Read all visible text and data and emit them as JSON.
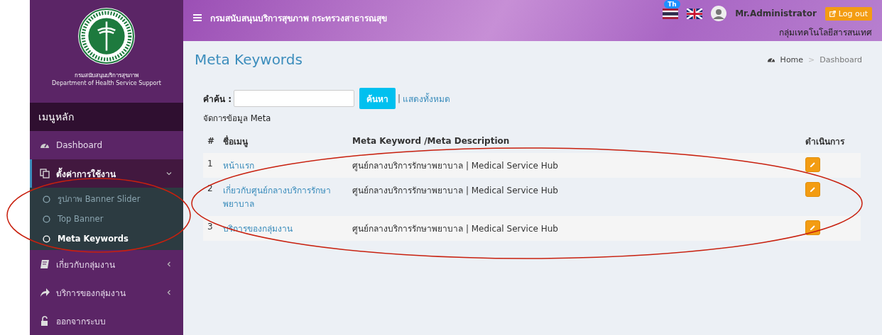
{
  "header": {
    "title": "กรมสนับสนุนบริการสุขภาพ กระทรวงสาธารณสุข",
    "language_badge": "Th",
    "user_name": "Mr.Administrator",
    "logout": "Log out",
    "department": "กลุ่มเทคโนโลยีสารสนเทศ"
  },
  "sidebar": {
    "org_name_th": "กรมสนับสนุนบริการสุขภาพ",
    "org_name_en": "Department of Health Service Support",
    "menu_heading": "เมนูหลัก",
    "items": [
      {
        "kind": "link",
        "label": "Dashboard"
      },
      {
        "kind": "group",
        "label": "ตั้งค่าการใช้งาน",
        "expanded": true,
        "children": [
          {
            "label": "รูปภาพ Banner Slider",
            "selected": false
          },
          {
            "label": "Top Banner",
            "selected": false
          },
          {
            "label": "Meta Keywords",
            "selected": true
          }
        ]
      },
      {
        "kind": "group",
        "label": "เกี่ยวกับกลุ่มงาน",
        "expanded": false
      },
      {
        "kind": "group",
        "label": "บริการของกลุ่มงาน",
        "expanded": false
      },
      {
        "kind": "link",
        "label": "ออกจากระบบ"
      }
    ]
  },
  "page": {
    "title": "Meta Keywords",
    "breadcrumb": [
      "Home",
      "Dashboard"
    ],
    "breadcrumb_separator": ">",
    "search": {
      "label": "คำค้น :",
      "button": "ค้นหา",
      "divider": "|",
      "show_all": "แสดงทั้งหมด"
    },
    "section_title": "จัดการข้อมูล Meta",
    "table": {
      "columns": [
        "#",
        "ชื่อเมนู",
        "Meta Keyword /Meta Description",
        "ดำเนินการ"
      ],
      "rows": [
        {
          "number": "1",
          "menu": "หน้าแรก",
          "keyword": "ศูนย์กลางบริการรักษาพยาบาล | Medical Service Hub"
        },
        {
          "number": "2",
          "menu": "เกี่ยวกับศูนย์กลางบริการรักษาพยาบาล",
          "keyword": "ศูนย์กลางบริการรักษาพยาบาล | Medical Service Hub"
        },
        {
          "number": "3",
          "menu": "บริการของกลุ่มงาน",
          "keyword": "ศูนย์กลางบริการรักษาพยาบาล | Medical Service Hub"
        }
      ]
    }
  }
}
